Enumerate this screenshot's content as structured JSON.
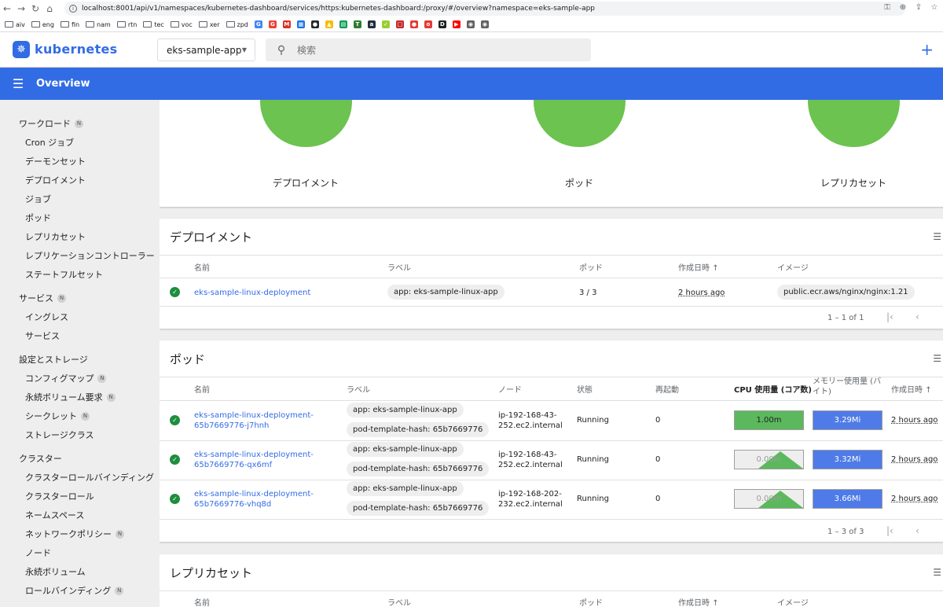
{
  "browser": {
    "url": "localhost:8001/api/v1/namespaces/kubernetes-dashboard/services/https:kubernetes-dashboard:/proxy/#/overview?namespace=eks-sample-app",
    "bookmarks": [
      "aiv",
      "eng",
      "fin",
      "nam",
      "rtn",
      "tec",
      "voc",
      "xer",
      "zpd"
    ]
  },
  "app": {
    "brand": "kubernetes",
    "namespace": "eks-sample-app",
    "search_placeholder": "検索",
    "page_title": "Overview"
  },
  "sidebar": {
    "sections": [
      {
        "label": "ワークロード",
        "badge": "N",
        "items": [
          {
            "label": "Cron ジョブ"
          },
          {
            "label": "デーモンセット"
          },
          {
            "label": "デプロイメント"
          },
          {
            "label": "ジョブ"
          },
          {
            "label": "ポッド"
          },
          {
            "label": "レプリカセット"
          },
          {
            "label": "レプリケーションコントローラー"
          },
          {
            "label": "ステートフルセット"
          }
        ]
      },
      {
        "label": "サービス",
        "badge": "N",
        "items": [
          {
            "label": "イングレス"
          },
          {
            "label": "サービス"
          }
        ]
      },
      {
        "label": "設定とストレージ",
        "items": [
          {
            "label": "コンフィグマップ",
            "badge": "N"
          },
          {
            "label": "永続ボリューム要求",
            "badge": "N"
          },
          {
            "label": "シークレット",
            "badge": "N"
          },
          {
            "label": "ストレージクラス"
          }
        ]
      },
      {
        "label": "クラスター",
        "items": [
          {
            "label": "クラスターロールバインディング"
          },
          {
            "label": "クラスターロール"
          },
          {
            "label": "ネームスペース"
          },
          {
            "label": "ネットワークポリシー",
            "badge": "N"
          },
          {
            "label": "ノード"
          },
          {
            "label": "永続ボリューム"
          },
          {
            "label": "ロールバインディング",
            "badge": "N"
          }
        ]
      }
    ]
  },
  "summary": {
    "labels": [
      "デプロイメント",
      "ポッド",
      "レプリカセット"
    ]
  },
  "deployments": {
    "title": "デプロイメント",
    "headers": [
      "名前",
      "ラベル",
      "ポッド",
      "作成日時",
      "イメージ"
    ],
    "sort_arrow": "↑",
    "rows": [
      {
        "name": "eks-sample-linux-deployment",
        "label": "app: eks-sample-linux-app",
        "pods": "3 / 3",
        "created": "2 hours ago",
        "image": "public.ecr.aws/nginx/nginx:1.21"
      }
    ],
    "pagination": "1 – 1 of 1"
  },
  "pods": {
    "title": "ポッド",
    "headers": [
      "名前",
      "ラベル",
      "ノード",
      "状態",
      "再起動",
      "CPU 使用量 (コア数)",
      "メモリー使用量 (バ",
      "イト)",
      "作成日時"
    ],
    "sort_arrow": "↑",
    "rows": [
      {
        "name1": "eks-sample-linux-deployment-",
        "name2": "65b7669776-j7hnh",
        "label1": "app: eks-sample-linux-app",
        "label2": "pod-template-hash: 65b7669776",
        "node1": "ip-192-168-43-",
        "node2": "252.ec2.internal",
        "status": "Running",
        "restarts": "0",
        "cpu": "1.00m",
        "mem": "3.29Mi",
        "created": "2 hours ago",
        "cpu_level": 1.0
      },
      {
        "name1": "eks-sample-linux-deployment-",
        "name2": "65b7669776-qx6mf",
        "label1": "app: eks-sample-linux-app",
        "label2": "pod-template-hash: 65b7669776",
        "node1": "ip-192-168-43-",
        "node2": "252.ec2.internal",
        "status": "Running",
        "restarts": "0",
        "cpu": "0.00m",
        "mem": "3.32Mi",
        "created": "2 hours ago",
        "cpu_level": 0.0
      },
      {
        "name1": "eks-sample-linux-deployment-",
        "name2": "65b7669776-vhq8d",
        "label1": "app: eks-sample-linux-app",
        "label2": "pod-template-hash: 65b7669776",
        "node1": "ip-192-168-202-",
        "node2": "232.ec2.internal",
        "status": "Running",
        "restarts": "0",
        "cpu": "0.00m",
        "mem": "3.66Mi",
        "created": "2 hours ago",
        "cpu_level": 0.0
      }
    ],
    "pagination": "1 – 3 of 3"
  },
  "replicasets": {
    "title": "レプリカセット",
    "headers": [
      "名前",
      "ラベル",
      "ポッド",
      "作成日時",
      "イメージ"
    ],
    "sort_arrow": "↑"
  },
  "colors": {
    "primary": "#326ce5",
    "ok": "#1e8e3e",
    "summary_green": "#6cc34f",
    "cpu_green": "#5cb85c",
    "mem_blue": "#4f7be8"
  }
}
